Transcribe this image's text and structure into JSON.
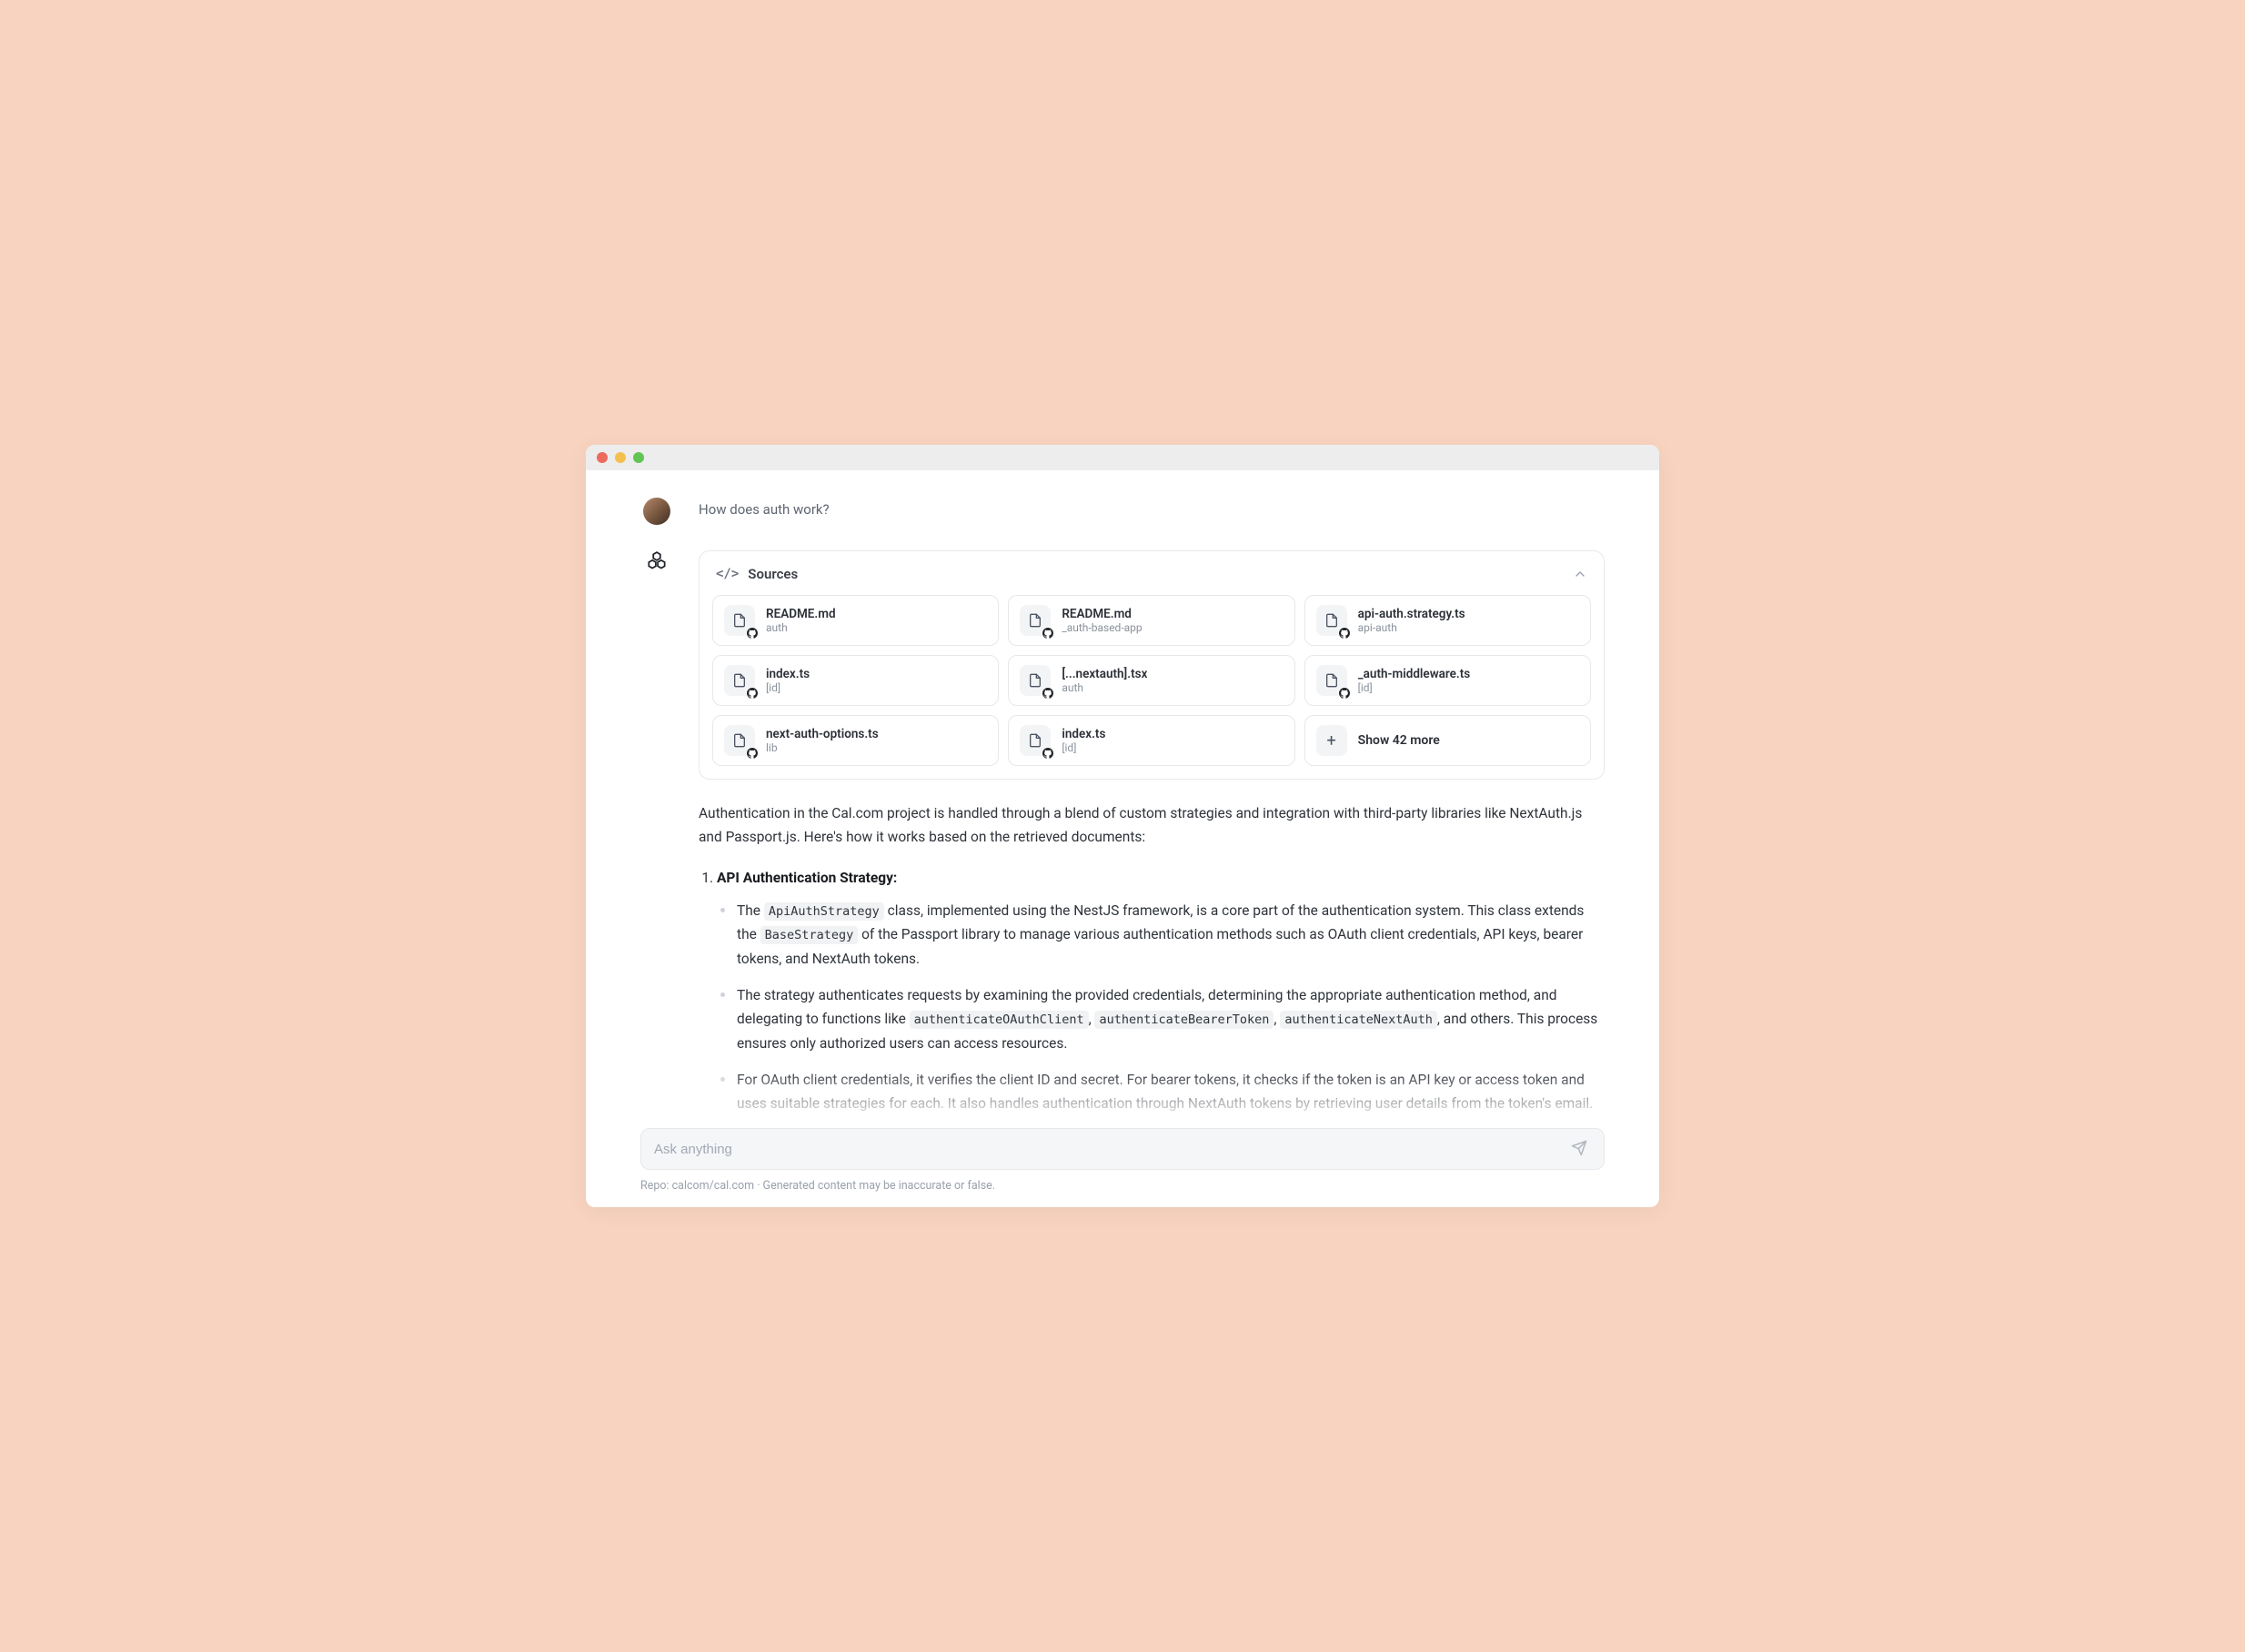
{
  "user_question": "How does auth work?",
  "sources": {
    "title": "Sources",
    "tiles": [
      {
        "name": "README.md",
        "path": "auth"
      },
      {
        "name": "README.md",
        "path": "_auth-based-app"
      },
      {
        "name": "api-auth.strategy.ts",
        "path": "api-auth"
      },
      {
        "name": "index.ts",
        "path": "[id]"
      },
      {
        "name": "[...nextauth].tsx",
        "path": "auth"
      },
      {
        "name": "_auth-middleware.ts",
        "path": "[id]"
      },
      {
        "name": "next-auth-options.ts",
        "path": "lib"
      },
      {
        "name": "index.ts",
        "path": "[id]"
      }
    ],
    "more_label": "Show 42 more"
  },
  "answer": {
    "intro": "Authentication in the Cal.com project is handled through a blend of custom strategies and integration with third-party libraries like NextAuth.js and Passport.js. Here's how it works based on the retrieved documents:",
    "section1_number": "1.",
    "section1_title": "API Authentication Strategy:",
    "b1_a": "The ",
    "b1_c1": "ApiAuthStrategy",
    "b1_b": " class, implemented using the NestJS framework, is a core part of the authentication system. This class extends the ",
    "b1_c2": "BaseStrategy",
    "b1_c": " of the Passport library to manage various authentication methods such as OAuth client credentials, API keys, bearer tokens, and NextAuth tokens.",
    "b2_a": "The strategy authenticates requests by examining the provided credentials, determining the appropriate authentication method, and delegating to functions like ",
    "b2_c1": "authenticateOAuthClient",
    "b2_b": ", ",
    "b2_c2": "authenticateBearerToken",
    "b2_c": ", ",
    "b2_c3": "authenticateNextAuth",
    "b2_d": ", and others. This process ensures only authorized users can access resources.",
    "b3": "For OAuth client credentials, it verifies the client ID and secret. For bearer tokens, it checks if the token is an API key or access token and uses suitable strategies for each. It also handles authentication through NextAuth tokens by retrieving user details from the token's email."
  },
  "input": {
    "placeholder": "Ask anything"
  },
  "footer": "Repo: calcom/cal.com · Generated content may be inaccurate or false."
}
